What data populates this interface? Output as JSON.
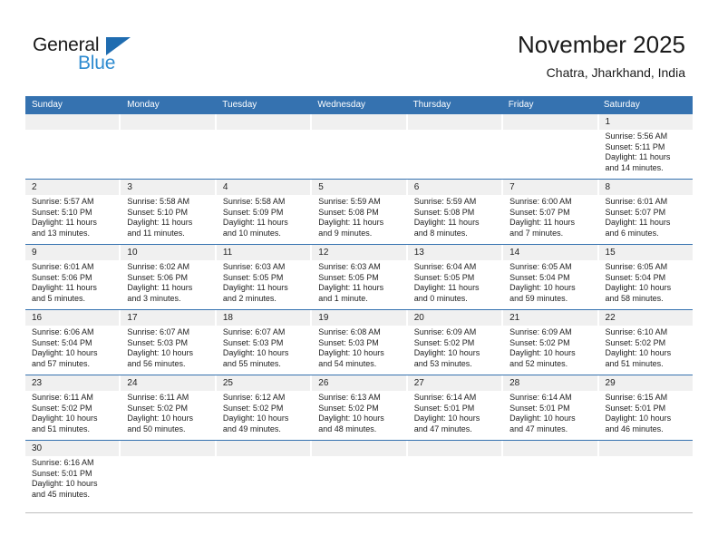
{
  "brand": {
    "name_part1": "General",
    "name_part2": "Blue",
    "triangle_color": "#1f6cb0",
    "blue_text_color": "#2E8BD0"
  },
  "header": {
    "title": "November 2025",
    "subtitle": "Chatra, Jharkhand, India"
  },
  "theme": {
    "header_blue": "#3572B0",
    "day_band_gray": "#f0f0f0",
    "row_divider": "#3572B0"
  },
  "weekdays": [
    "Sunday",
    "Monday",
    "Tuesday",
    "Wednesday",
    "Thursday",
    "Friday",
    "Saturday"
  ],
  "weeks": [
    [
      {
        "day": "",
        "sunrise": "",
        "sunset": "",
        "daylight_line1": "",
        "daylight_line2": "",
        "empty": true
      },
      {
        "day": "",
        "sunrise": "",
        "sunset": "",
        "daylight_line1": "",
        "daylight_line2": "",
        "empty": true
      },
      {
        "day": "",
        "sunrise": "",
        "sunset": "",
        "daylight_line1": "",
        "daylight_line2": "",
        "empty": true
      },
      {
        "day": "",
        "sunrise": "",
        "sunset": "",
        "daylight_line1": "",
        "daylight_line2": "",
        "empty": true
      },
      {
        "day": "",
        "sunrise": "",
        "sunset": "",
        "daylight_line1": "",
        "daylight_line2": "",
        "empty": true
      },
      {
        "day": "",
        "sunrise": "",
        "sunset": "",
        "daylight_line1": "",
        "daylight_line2": "",
        "empty": true
      },
      {
        "day": "1",
        "sunrise": "Sunrise: 5:56 AM",
        "sunset": "Sunset: 5:11 PM",
        "daylight_line1": "Daylight: 11 hours",
        "daylight_line2": "and 14 minutes."
      }
    ],
    [
      {
        "day": "2",
        "sunrise": "Sunrise: 5:57 AM",
        "sunset": "Sunset: 5:10 PM",
        "daylight_line1": "Daylight: 11 hours",
        "daylight_line2": "and 13 minutes."
      },
      {
        "day": "3",
        "sunrise": "Sunrise: 5:58 AM",
        "sunset": "Sunset: 5:10 PM",
        "daylight_line1": "Daylight: 11 hours",
        "daylight_line2": "and 11 minutes."
      },
      {
        "day": "4",
        "sunrise": "Sunrise: 5:58 AM",
        "sunset": "Sunset: 5:09 PM",
        "daylight_line1": "Daylight: 11 hours",
        "daylight_line2": "and 10 minutes."
      },
      {
        "day": "5",
        "sunrise": "Sunrise: 5:59 AM",
        "sunset": "Sunset: 5:08 PM",
        "daylight_line1": "Daylight: 11 hours",
        "daylight_line2": "and 9 minutes."
      },
      {
        "day": "6",
        "sunrise": "Sunrise: 5:59 AM",
        "sunset": "Sunset: 5:08 PM",
        "daylight_line1": "Daylight: 11 hours",
        "daylight_line2": "and 8 minutes."
      },
      {
        "day": "7",
        "sunrise": "Sunrise: 6:00 AM",
        "sunset": "Sunset: 5:07 PM",
        "daylight_line1": "Daylight: 11 hours",
        "daylight_line2": "and 7 minutes."
      },
      {
        "day": "8",
        "sunrise": "Sunrise: 6:01 AM",
        "sunset": "Sunset: 5:07 PM",
        "daylight_line1": "Daylight: 11 hours",
        "daylight_line2": "and 6 minutes."
      }
    ],
    [
      {
        "day": "9",
        "sunrise": "Sunrise: 6:01 AM",
        "sunset": "Sunset: 5:06 PM",
        "daylight_line1": "Daylight: 11 hours",
        "daylight_line2": "and 5 minutes."
      },
      {
        "day": "10",
        "sunrise": "Sunrise: 6:02 AM",
        "sunset": "Sunset: 5:06 PM",
        "daylight_line1": "Daylight: 11 hours",
        "daylight_line2": "and 3 minutes."
      },
      {
        "day": "11",
        "sunrise": "Sunrise: 6:03 AM",
        "sunset": "Sunset: 5:05 PM",
        "daylight_line1": "Daylight: 11 hours",
        "daylight_line2": "and 2 minutes."
      },
      {
        "day": "12",
        "sunrise": "Sunrise: 6:03 AM",
        "sunset": "Sunset: 5:05 PM",
        "daylight_line1": "Daylight: 11 hours",
        "daylight_line2": "and 1 minute."
      },
      {
        "day": "13",
        "sunrise": "Sunrise: 6:04 AM",
        "sunset": "Sunset: 5:05 PM",
        "daylight_line1": "Daylight: 11 hours",
        "daylight_line2": "and 0 minutes."
      },
      {
        "day": "14",
        "sunrise": "Sunrise: 6:05 AM",
        "sunset": "Sunset: 5:04 PM",
        "daylight_line1": "Daylight: 10 hours",
        "daylight_line2": "and 59 minutes."
      },
      {
        "day": "15",
        "sunrise": "Sunrise: 6:05 AM",
        "sunset": "Sunset: 5:04 PM",
        "daylight_line1": "Daylight: 10 hours",
        "daylight_line2": "and 58 minutes."
      }
    ],
    [
      {
        "day": "16",
        "sunrise": "Sunrise: 6:06 AM",
        "sunset": "Sunset: 5:04 PM",
        "daylight_line1": "Daylight: 10 hours",
        "daylight_line2": "and 57 minutes."
      },
      {
        "day": "17",
        "sunrise": "Sunrise: 6:07 AM",
        "sunset": "Sunset: 5:03 PM",
        "daylight_line1": "Daylight: 10 hours",
        "daylight_line2": "and 56 minutes."
      },
      {
        "day": "18",
        "sunrise": "Sunrise: 6:07 AM",
        "sunset": "Sunset: 5:03 PM",
        "daylight_line1": "Daylight: 10 hours",
        "daylight_line2": "and 55 minutes."
      },
      {
        "day": "19",
        "sunrise": "Sunrise: 6:08 AM",
        "sunset": "Sunset: 5:03 PM",
        "daylight_line1": "Daylight: 10 hours",
        "daylight_line2": "and 54 minutes."
      },
      {
        "day": "20",
        "sunrise": "Sunrise: 6:09 AM",
        "sunset": "Sunset: 5:02 PM",
        "daylight_line1": "Daylight: 10 hours",
        "daylight_line2": "and 53 minutes."
      },
      {
        "day": "21",
        "sunrise": "Sunrise: 6:09 AM",
        "sunset": "Sunset: 5:02 PM",
        "daylight_line1": "Daylight: 10 hours",
        "daylight_line2": "and 52 minutes."
      },
      {
        "day": "22",
        "sunrise": "Sunrise: 6:10 AM",
        "sunset": "Sunset: 5:02 PM",
        "daylight_line1": "Daylight: 10 hours",
        "daylight_line2": "and 51 minutes."
      }
    ],
    [
      {
        "day": "23",
        "sunrise": "Sunrise: 6:11 AM",
        "sunset": "Sunset: 5:02 PM",
        "daylight_line1": "Daylight: 10 hours",
        "daylight_line2": "and 51 minutes."
      },
      {
        "day": "24",
        "sunrise": "Sunrise: 6:11 AM",
        "sunset": "Sunset: 5:02 PM",
        "daylight_line1": "Daylight: 10 hours",
        "daylight_line2": "and 50 minutes."
      },
      {
        "day": "25",
        "sunrise": "Sunrise: 6:12 AM",
        "sunset": "Sunset: 5:02 PM",
        "daylight_line1": "Daylight: 10 hours",
        "daylight_line2": "and 49 minutes."
      },
      {
        "day": "26",
        "sunrise": "Sunrise: 6:13 AM",
        "sunset": "Sunset: 5:02 PM",
        "daylight_line1": "Daylight: 10 hours",
        "daylight_line2": "and 48 minutes."
      },
      {
        "day": "27",
        "sunrise": "Sunrise: 6:14 AM",
        "sunset": "Sunset: 5:01 PM",
        "daylight_line1": "Daylight: 10 hours",
        "daylight_line2": "and 47 minutes."
      },
      {
        "day": "28",
        "sunrise": "Sunrise: 6:14 AM",
        "sunset": "Sunset: 5:01 PM",
        "daylight_line1": "Daylight: 10 hours",
        "daylight_line2": "and 47 minutes."
      },
      {
        "day": "29",
        "sunrise": "Sunrise: 6:15 AM",
        "sunset": "Sunset: 5:01 PM",
        "daylight_line1": "Daylight: 10 hours",
        "daylight_line2": "and 46 minutes."
      }
    ],
    [
      {
        "day": "30",
        "sunrise": "Sunrise: 6:16 AM",
        "sunset": "Sunset: 5:01 PM",
        "daylight_line1": "Daylight: 10 hours",
        "daylight_line2": "and 45 minutes."
      },
      {
        "day": "",
        "sunrise": "",
        "sunset": "",
        "daylight_line1": "",
        "daylight_line2": "",
        "empty": true
      },
      {
        "day": "",
        "sunrise": "",
        "sunset": "",
        "daylight_line1": "",
        "daylight_line2": "",
        "empty": true
      },
      {
        "day": "",
        "sunrise": "",
        "sunset": "",
        "daylight_line1": "",
        "daylight_line2": "",
        "empty": true
      },
      {
        "day": "",
        "sunrise": "",
        "sunset": "",
        "daylight_line1": "",
        "daylight_line2": "",
        "empty": true
      },
      {
        "day": "",
        "sunrise": "",
        "sunset": "",
        "daylight_line1": "",
        "daylight_line2": "",
        "empty": true
      },
      {
        "day": "",
        "sunrise": "",
        "sunset": "",
        "daylight_line1": "",
        "daylight_line2": "",
        "empty": true
      }
    ]
  ]
}
